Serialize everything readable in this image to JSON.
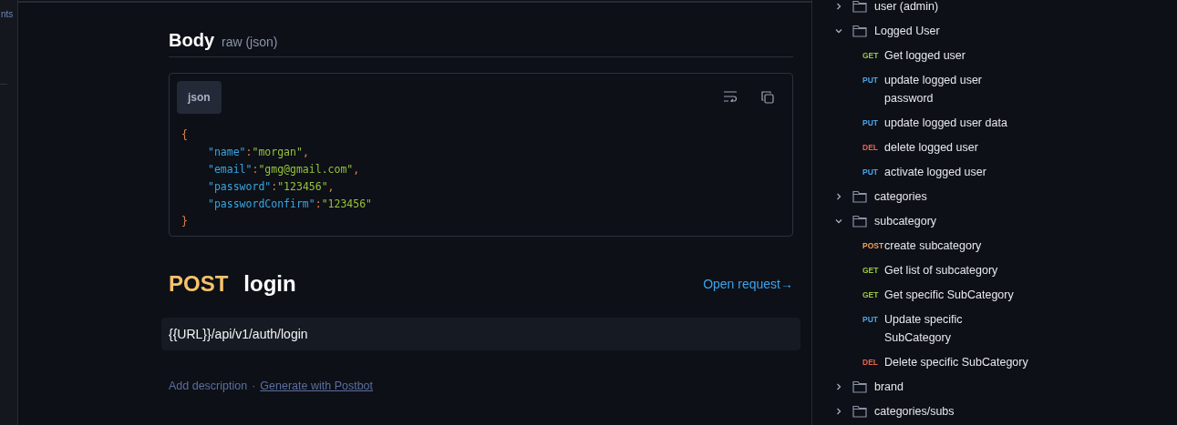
{
  "left_rail": {
    "label": "nts"
  },
  "body_section": {
    "title": "Body",
    "subtitle": "raw (json)",
    "language": "json",
    "code": {
      "open": "{",
      "close": "}",
      "entries": [
        {
          "key": "\"name\"",
          "sep": ":",
          "value": "\"morgan\"",
          "comma": ","
        },
        {
          "key": "\"email\"",
          "sep": ":",
          "value": "\"gmg@gmail.com\"",
          "comma": ","
        },
        {
          "key": "\"password\"",
          "sep": ":",
          "value": "\"123456\"",
          "comma": ","
        },
        {
          "key": "\"passwordConfirm\"",
          "sep": ":",
          "value": "\"123456\""
        }
      ]
    }
  },
  "request": {
    "method": "POST",
    "name": "login",
    "open_link": "Open request→",
    "url": "{{URL}}/api/v1/auth/login",
    "add_description": "Add description",
    "separator": "·",
    "postbot_link": "Generate with Postbot"
  },
  "sidebar": {
    "items": [
      {
        "kind": "folder",
        "label": "user (admin)",
        "expanded": false
      },
      {
        "kind": "folder",
        "label": "Logged User",
        "expanded": true,
        "children": [
          {
            "method": "GET",
            "color": "#9bc53d",
            "label": "Get logged user"
          },
          {
            "method": "PUT",
            "color": "#4aa3e8",
            "label": "update logged user password"
          },
          {
            "method": "PUT",
            "color": "#4aa3e8",
            "label": "update logged user data"
          },
          {
            "method": "DEL",
            "color": "#e5634f",
            "label": "delete logged user"
          },
          {
            "method": "PUT",
            "color": "#4aa3e8",
            "label": "activate logged user"
          }
        ]
      },
      {
        "kind": "folder",
        "label": "categories",
        "expanded": false
      },
      {
        "kind": "folder",
        "label": "subcategory",
        "expanded": true,
        "children": [
          {
            "method": "POST",
            "color": "#f0a35a",
            "label": "create subcategory"
          },
          {
            "method": "GET",
            "color": "#9bc53d",
            "label": "Get list of subcategory"
          },
          {
            "method": "GET",
            "color": "#9bc53d",
            "label": "Get specific SubCategory"
          },
          {
            "method": "PUT",
            "color": "#4aa3e8",
            "label": "Update specific SubCategory"
          },
          {
            "method": "DEL",
            "color": "#e5634f",
            "label": "Delete specific SubCategory"
          }
        ]
      },
      {
        "kind": "folder",
        "label": "brand",
        "expanded": false
      },
      {
        "kind": "folder",
        "label": "categories/subs",
        "expanded": false
      }
    ]
  }
}
